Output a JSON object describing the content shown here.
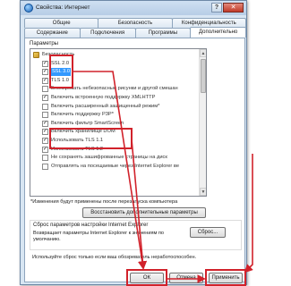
{
  "window": {
    "title": "Свойства: Интернет",
    "help_glyph": "?",
    "close_glyph": "✕"
  },
  "tabs": {
    "row1": [
      "Общие",
      "Безопасность",
      "Конфиденциальность"
    ],
    "row2": [
      "Содержание",
      "Подключения",
      "Программы",
      "Дополнительно"
    ],
    "active": "Дополнительно"
  },
  "settings": {
    "group_label": "Параметры",
    "items": [
      {
        "text": "Безопасность",
        "kind": "category",
        "indent": 0
      },
      {
        "text": "SSL 2.0",
        "kind": "checkbox",
        "checked": true,
        "highlighted": false,
        "indent": 1
      },
      {
        "text": "SSL 3.0",
        "kind": "checkbox",
        "checked": true,
        "highlighted": true,
        "indent": 1
      },
      {
        "text": "TLS 1.0",
        "kind": "checkbox",
        "checked": true,
        "highlighted": false,
        "indent": 1
      },
      {
        "text": "Блокировать небезопасные рисунки и другой смешан",
        "kind": "checkbox",
        "checked": false,
        "highlighted": false,
        "indent": 1
      },
      {
        "text": "Включить встроенную поддержку XMLHTTP",
        "kind": "checkbox",
        "checked": true,
        "highlighted": false,
        "indent": 1
      },
      {
        "text": "Включить расширенный защищенный режим*",
        "kind": "checkbox",
        "checked": false,
        "highlighted": false,
        "indent": 1
      },
      {
        "text": "Включить поддержку P3P*",
        "kind": "checkbox",
        "checked": false,
        "highlighted": false,
        "indent": 1
      },
      {
        "text": "Включить фильтр SmartScreen",
        "kind": "checkbox",
        "checked": true,
        "highlighted": false,
        "indent": 1
      },
      {
        "text": "Включить хранилище DOM",
        "kind": "checkbox",
        "checked": true,
        "highlighted": false,
        "indent": 1
      },
      {
        "text": "Использовать TLS 1.1",
        "kind": "checkbox",
        "checked": true,
        "highlighted": false,
        "indent": 1
      },
      {
        "text": "Использовать TLS 1.2",
        "kind": "checkbox",
        "checked": true,
        "highlighted": false,
        "indent": 1
      },
      {
        "text": "Не сохранять зашифрованные страницы на диск",
        "kind": "checkbox",
        "checked": false,
        "highlighted": false,
        "indent": 1
      },
      {
        "text": "Отправлять на посещаемые через Internet Explorer ве",
        "kind": "checkbox",
        "checked": false,
        "highlighted": false,
        "indent": 1
      }
    ],
    "restart_note": "*Изменения будут применены после перезапуска компьютера",
    "restore_button": "Восстановить дополнительные параметры"
  },
  "reset_section": {
    "title": "Сброс параметров настройки Internet Explorer",
    "description": "Возвращает параметры Internet Explorer к значениям по умолчанию.",
    "reset_button": "Сброс...",
    "note": "Используйте сброс только если ваш обозреватель неработоспособен."
  },
  "footer": {
    "ok": "ОК",
    "cancel": "Отмена",
    "apply": "Применить"
  },
  "colors": {
    "annotation_red": "#d1222b",
    "selection_blue": "#3399ff"
  }
}
